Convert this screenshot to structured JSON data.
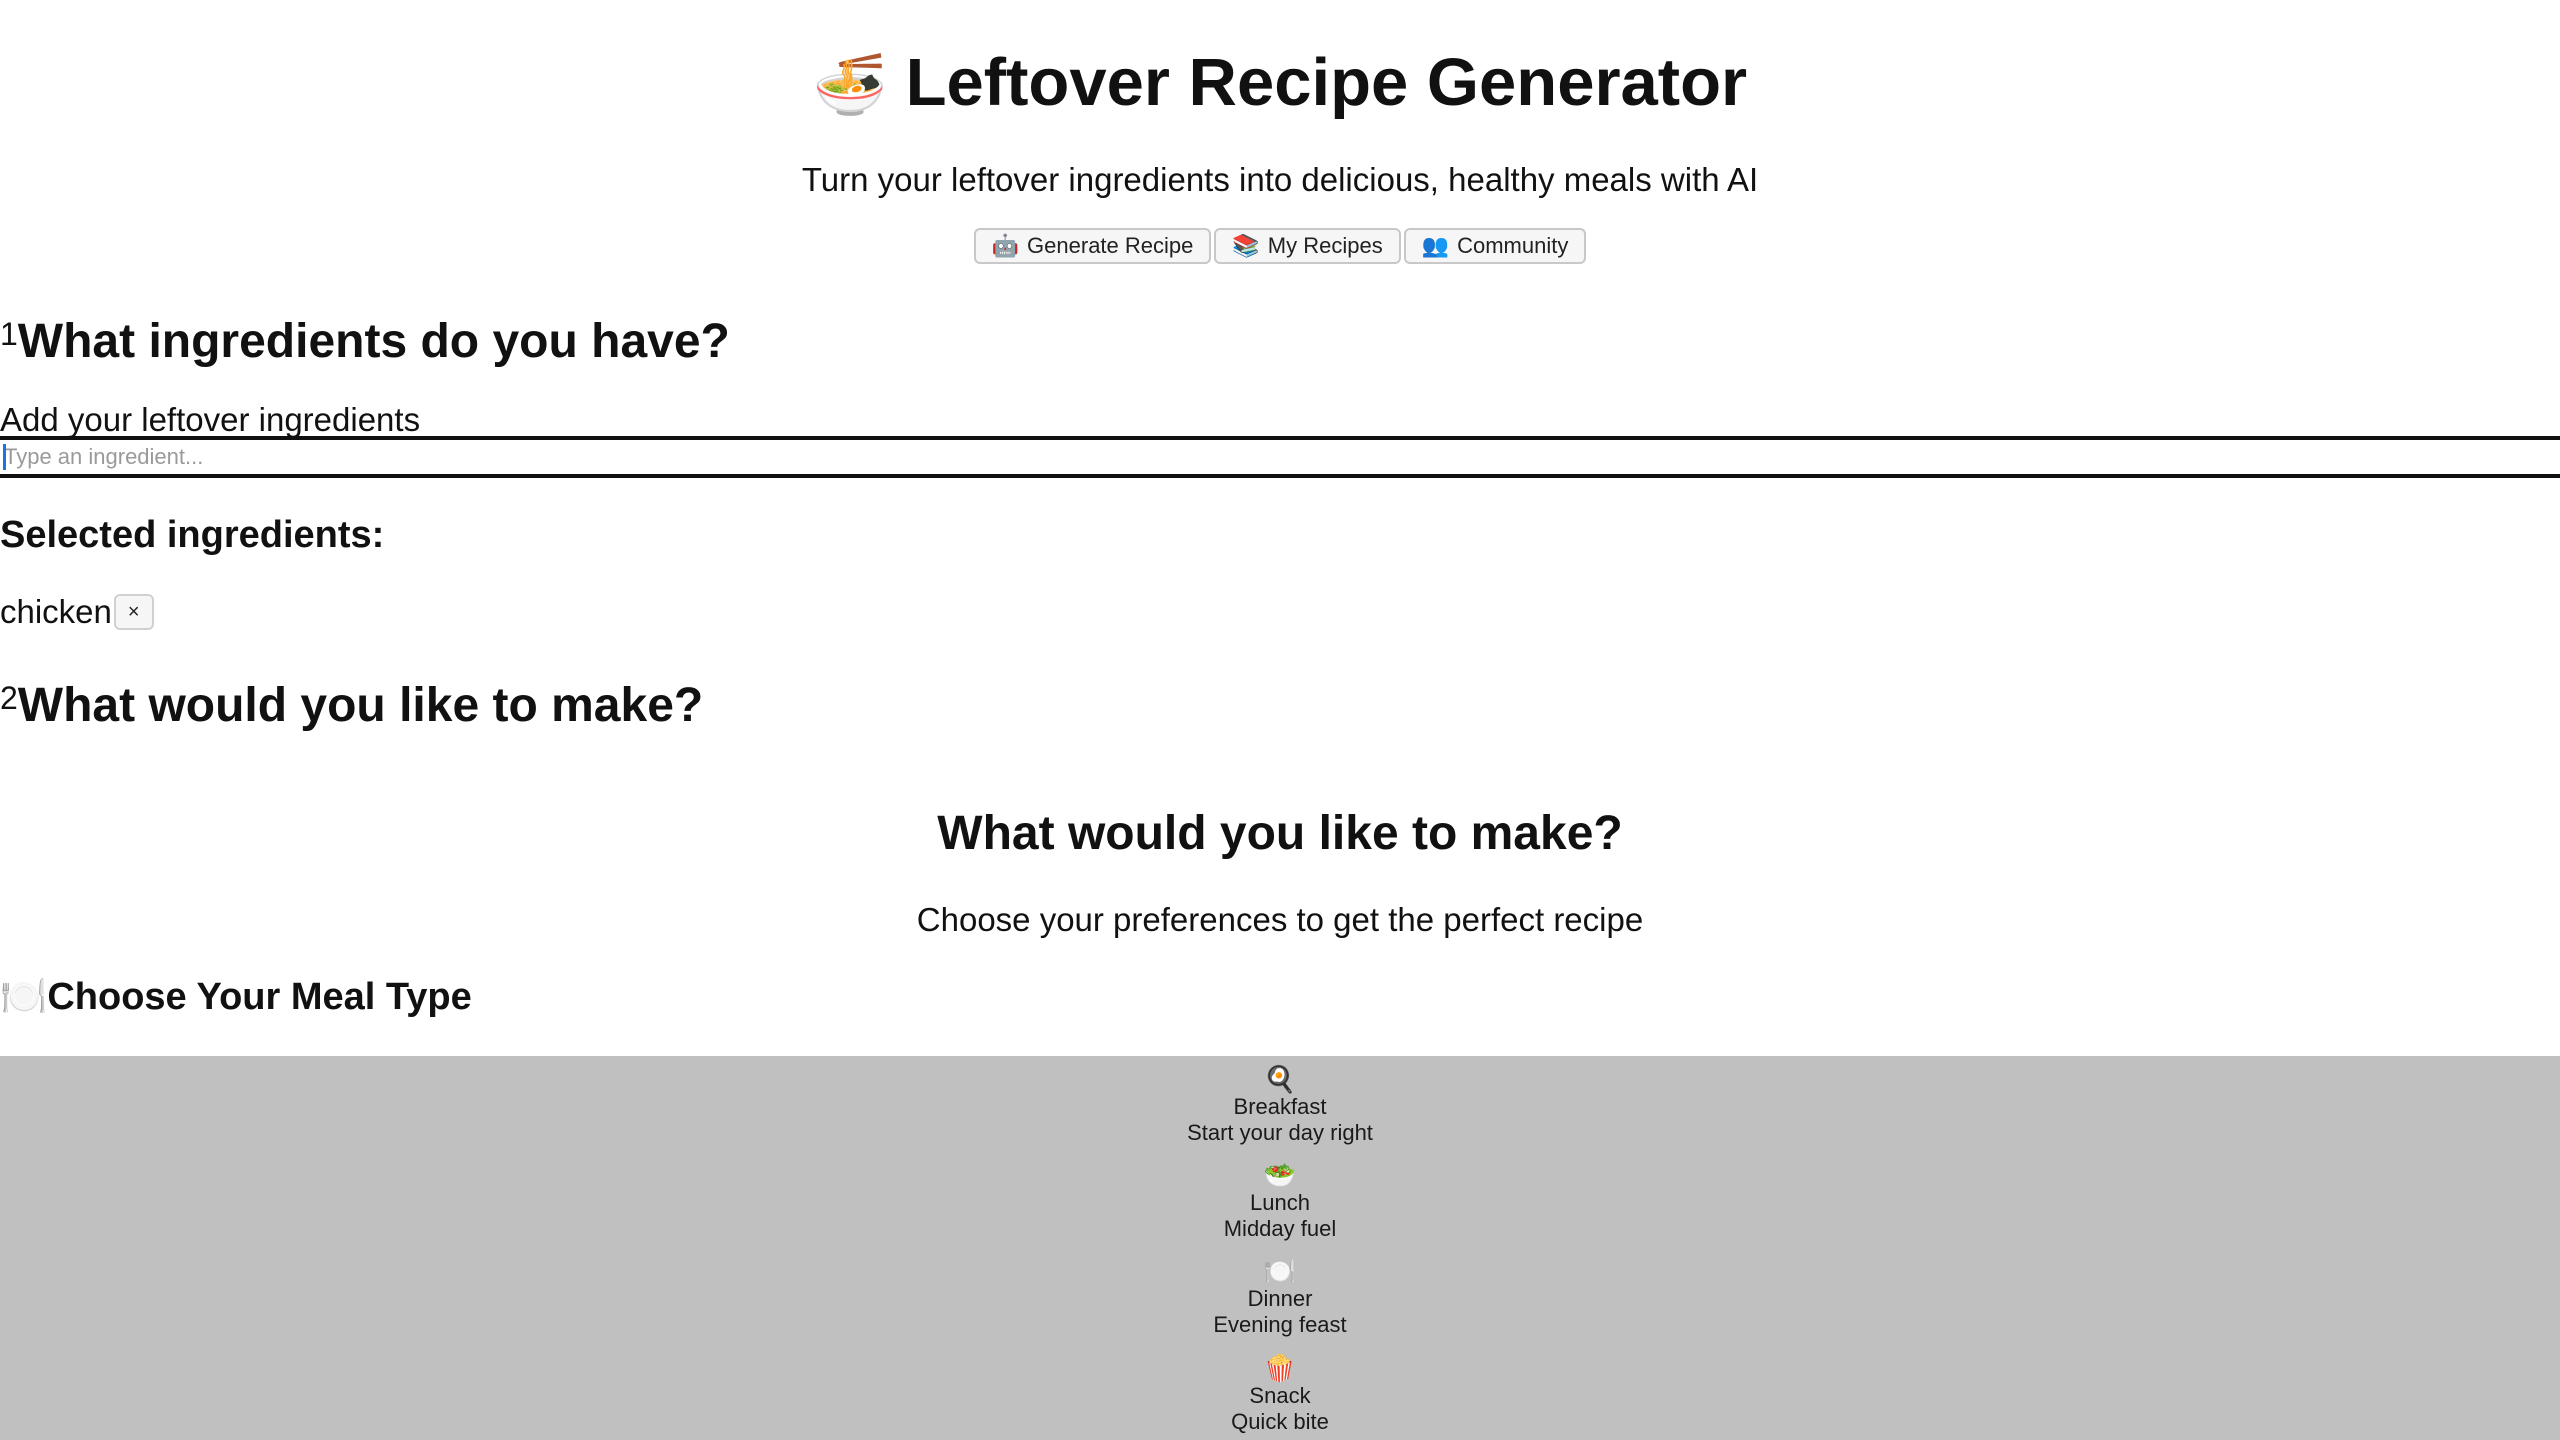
{
  "header": {
    "icon": "🍜",
    "title": "Leftover Recipe Generator",
    "subtitle": "Turn your leftover ingredients into delicious, healthy meals with AI"
  },
  "nav": [
    {
      "icon": "🤖",
      "label": "Generate Recipe"
    },
    {
      "icon": "📚",
      "label": "My Recipes"
    },
    {
      "icon": "👥",
      "label": "Community"
    }
  ],
  "step1": {
    "number": "1",
    "title": "What ingredients do you have?",
    "field_label": "Add your leftover ingredients",
    "input_value": "",
    "input_placeholder": "Type an ingredient...",
    "selected_heading": "Selected ingredients:",
    "selected": [
      {
        "name": "chicken",
        "remove": "×"
      }
    ]
  },
  "step2": {
    "number": "2",
    "title": "What would you like to make?",
    "center_title": "What would you like to make?",
    "center_subtitle": "Choose your preferences to get the perfect recipe",
    "meal_heading_icon": "🍽️",
    "meal_heading": "Choose Your Meal Type",
    "meal_types": [
      {
        "icon": "🍳",
        "name": "Breakfast",
        "desc": "Start your day right"
      },
      {
        "icon": "🥗",
        "name": "Lunch",
        "desc": "Midday fuel"
      },
      {
        "icon": "🍽️",
        "name": "Dinner",
        "desc": "Evening feast"
      },
      {
        "icon": "🍿",
        "name": "Snack",
        "desc": "Quick bite"
      }
    ]
  },
  "colors": {
    "panel_bg": "#c0c0c0",
    "caret": "#1a73e8"
  }
}
